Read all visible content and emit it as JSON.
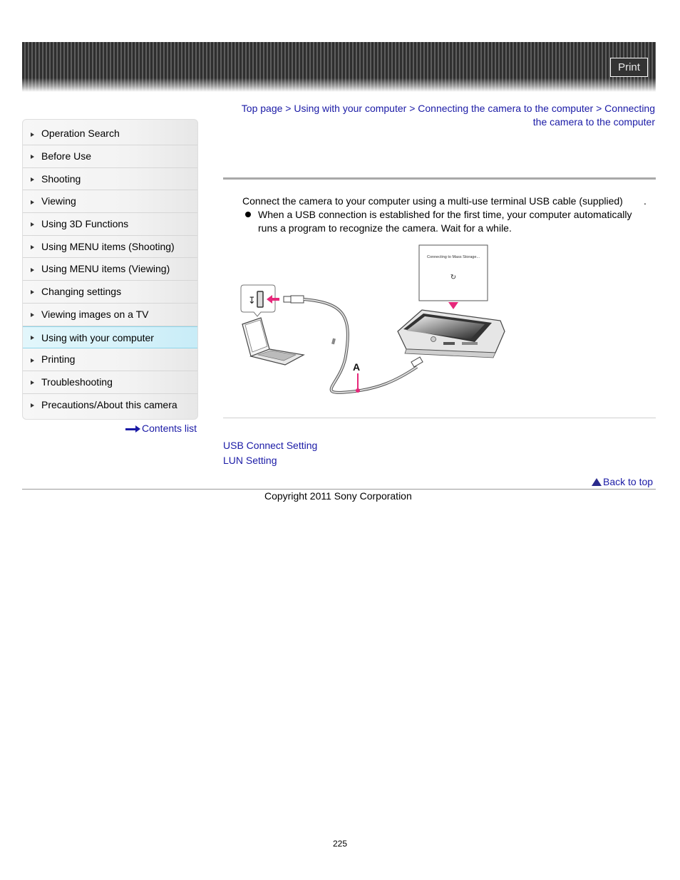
{
  "header": {
    "print_label": "Print"
  },
  "sidebar": {
    "items": [
      {
        "label": "Operation Search",
        "active": false
      },
      {
        "label": "Before Use",
        "active": false
      },
      {
        "label": "Shooting",
        "active": false
      },
      {
        "label": "Viewing",
        "active": false
      },
      {
        "label": "Using 3D Functions",
        "active": false
      },
      {
        "label": "Using MENU items (Shooting)",
        "active": false
      },
      {
        "label": "Using MENU items (Viewing)",
        "active": false
      },
      {
        "label": "Changing settings",
        "active": false
      },
      {
        "label": "Viewing images on a TV",
        "active": false
      },
      {
        "label": "Using with your computer",
        "active": true
      },
      {
        "label": "Printing",
        "active": false
      },
      {
        "label": "Troubleshooting",
        "active": false
      },
      {
        "label": "Precautions/About this camera",
        "active": false
      }
    ],
    "contents_list_label": "Contents list"
  },
  "breadcrumb": {
    "items": [
      "Top page",
      "Using with your computer",
      "Connecting the camera to the computer",
      "Connecting the camera to the computer"
    ],
    "separator": ">"
  },
  "main": {
    "step_text": "Connect the camera to your computer using a multi-use terminal USB cable (supplied)",
    "step_end": ".",
    "bullet_text": "When a USB connection is established for the first time, your computer automatically runs a program to recognize the camera. Wait for a while.",
    "illustration": {
      "screen_message": "Connecting to Mass Storage...",
      "callout_label": "A",
      "accent_color": "#e6287a"
    },
    "related_links": [
      "USB Connect Setting",
      "LUN Setting"
    ],
    "back_to_top_label": "Back to top"
  },
  "footer": {
    "copyright": "Copyright 2011 Sony Corporation",
    "page_number": "225"
  }
}
